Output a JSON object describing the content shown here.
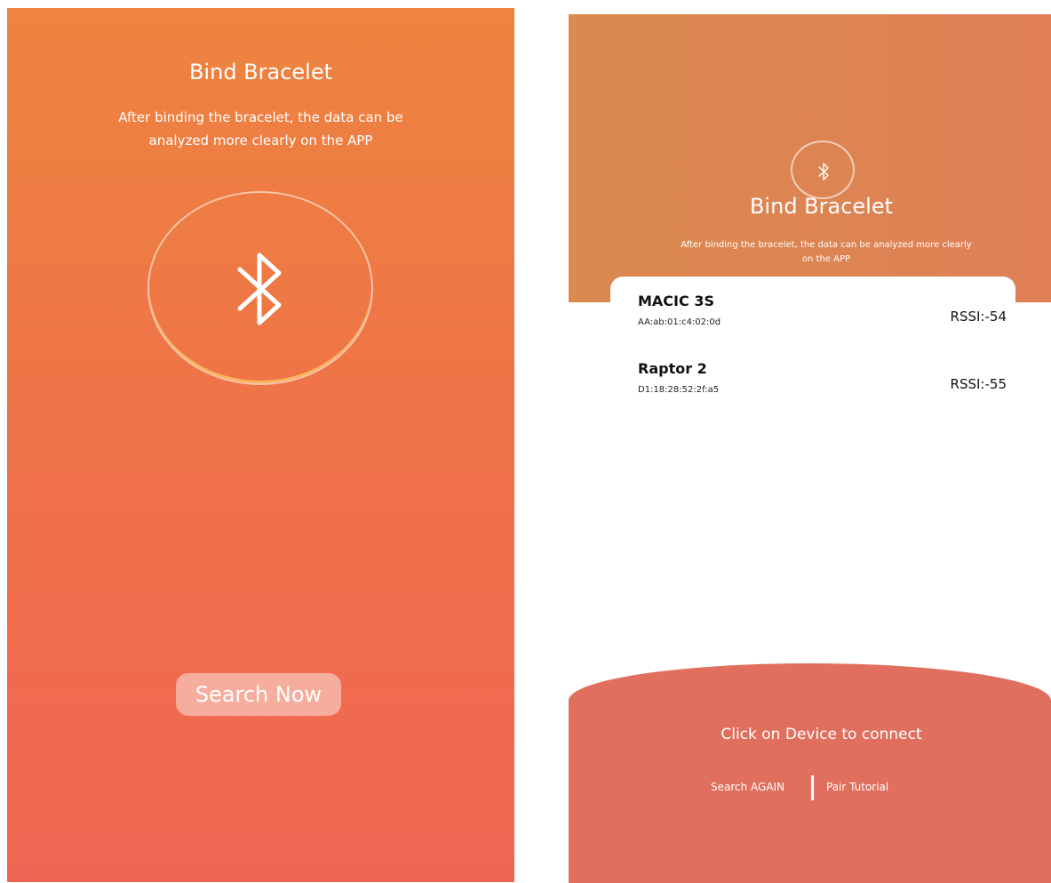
{
  "left_screen": {
    "title": "Bind Bracelet",
    "subtitle": "After binding the bracelet, the data can be analyzed more clearly on the APP",
    "icon": "bluetooth-icon",
    "search_button_label": "Search Now"
  },
  "right_screen": {
    "icon": "bluetooth-icon",
    "title": "Bind Bracelet",
    "subtitle": "After binding the bracelet, the data can be analyzed more clearly on the APP",
    "devices": [
      {
        "name": "MACIC 3S",
        "mac": "AA:ab:01:c4:02:0d",
        "rssi": "RSSI:-54"
      },
      {
        "name": "Raptor 2",
        "mac": "D1:18:28:52:2f:a5",
        "rssi": "RSSI:-55"
      }
    ],
    "hint": "Click on Device to connect",
    "search_again_label": "Search AGAIN",
    "pair_tutorial_label": "Pair Tutorial"
  },
  "colors": {
    "orange_top": "#ee843f",
    "orange_bottom": "#f06654",
    "header_orange": "#da8a4f",
    "bottom_coral": "#e06f5d"
  }
}
